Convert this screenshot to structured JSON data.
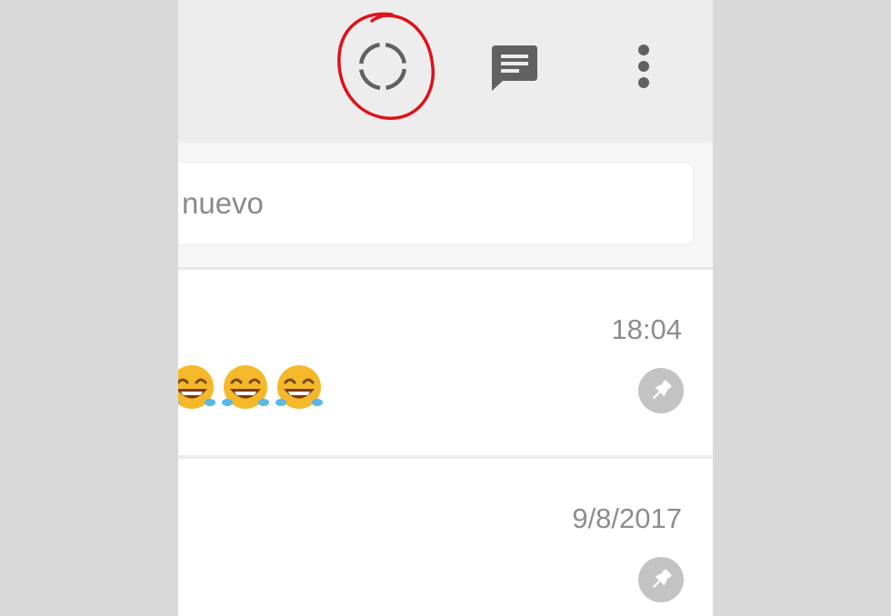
{
  "colors": {
    "header_bg": "#ededed",
    "icon_gray": "#616161",
    "annotation_red": "#e0101a",
    "timestamp_gray": "#8d8d8d",
    "pin_gray": "#c3c3c3"
  },
  "header": {
    "icons": [
      "status-icon",
      "new-chat-icon",
      "more-options-icon"
    ]
  },
  "search": {
    "placeholder": "nuevo"
  },
  "chats": [
    {
      "time": "18:04",
      "preview_emoji": "face-with-tears-of-joy",
      "emoji_count": 3,
      "pinned": true
    },
    {
      "time": "9/8/2017",
      "pinned": true
    }
  ]
}
